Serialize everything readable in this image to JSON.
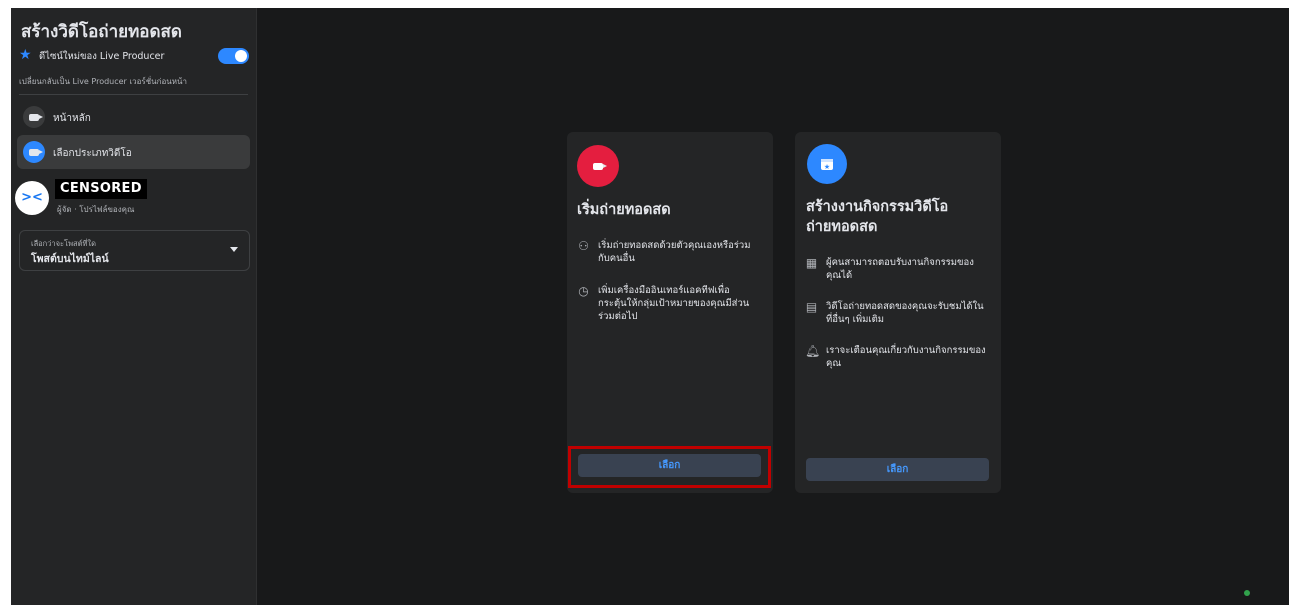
{
  "sidebar": {
    "title": "สร้างวิดีโอถ่ายทอดสด",
    "toggle_label": "ดีไซน์ใหม่ของ Live Producer",
    "switch_back": "เปลี่ยนกลับเป็น Live Producer เวอร์ชั่นก่อนหน้า",
    "nav": [
      {
        "label": "หน้าหลัก"
      },
      {
        "label": "เลือกประเภทวิดีโอ"
      }
    ],
    "profile": {
      "name": "CENSORED",
      "sub": "ผู้จัด · โปรไฟล์ของคุณ"
    },
    "dropdown": {
      "label": "เลือกว่าจะโพสต์ที่ใด",
      "value": "โพสต์บนไทม์ไลน์"
    }
  },
  "cards": [
    {
      "title": "เริ่มถ่ายทอดสด",
      "features": [
        {
          "icon": "people-icon",
          "text": "เริ่มถ่ายทอดสดด้วยตัวคุณเองหรือร่วมกับคนอื่น"
        },
        {
          "icon": "clock-icon",
          "text": "เพิ่มเครื่องมืออินเทอร์แอคทีฟเพื่อกระตุ้นให้กลุ่มเป้าหมายของคุณมีส่วนร่วมต่อไป"
        }
      ],
      "button": "เลือก"
    },
    {
      "title": "สร้างงานกิจกรรมวิดีโอถ่ายทอดสด",
      "features": [
        {
          "icon": "calendar-icon",
          "text": "ผู้คนสามารถตอบรับงานกิจกรรมของคุณได้"
        },
        {
          "icon": "video-library-icon",
          "text": "วิดีโอถ่ายทอดสดของคุณจะรับชมได้ในที่อื่นๆ เพิ่มเติม"
        },
        {
          "icon": "bell-icon",
          "text": "เราจะเตือนคุณเกี่ยวกับงานกิจกรรมของคุณ"
        }
      ],
      "button": "เลือก"
    }
  ],
  "colors": {
    "accent": "#2d88ff",
    "live_red": "#e41e3f",
    "highlight": "#c00000"
  }
}
